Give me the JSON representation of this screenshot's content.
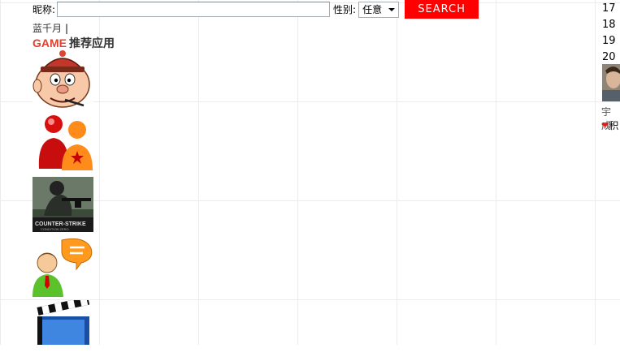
{
  "search": {
    "nickname_label": "昵称:",
    "nickname_value": "",
    "gender_label": "性别:",
    "gender_selected": "任意",
    "button_label": "SEARCH"
  },
  "user": {
    "name": "蓝千月",
    "separator": "|"
  },
  "section": {
    "title_en": "GAME",
    "title_cn": "推荐应用"
  },
  "apps": [
    {
      "icon": "cartoon-face-hat-icon"
    },
    {
      "icon": "messenger-people-icon"
    },
    {
      "icon": "counter-strike-icon",
      "text": "COUNTER STRIKE"
    },
    {
      "icon": "user-chat-bubble-icon"
    },
    {
      "icon": "movie-clapper-icon"
    }
  ],
  "right_panel": {
    "numbers": [
      "17",
      "18",
      "19",
      "20"
    ],
    "name": "宇成",
    "action": "积"
  },
  "colors": {
    "search_button": "#ff0000",
    "game_title": "#e2412f",
    "grid_line": "#ececec"
  }
}
